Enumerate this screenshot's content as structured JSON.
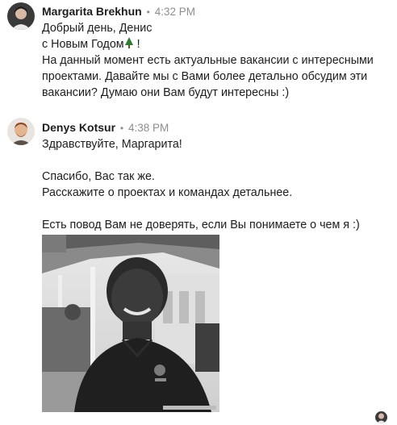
{
  "messages": [
    {
      "sender": "Margarita Brekhun",
      "time": "4:32 PM",
      "lines": [
        "Добрый день, Денис",
        "с Новым Годом",
        "На данный момент есть актуальные вакансии с интересными",
        "проектами. Давайте мы с Вами более детально обсудим эти",
        "вакансии? Думаю они Вам будут интересны :)"
      ],
      "inline_emoji": "tree-emoji",
      "after_emoji": " !"
    },
    {
      "sender": "Denys Kotsur",
      "time": "4:38 PM",
      "lines": [
        "Здравствуйте, Маргарита!",
        "Спасибо, Вас так же.",
        "Расскажите о проектах и командах детальнее.",
        "Есть повод Вам не доверять, если Вы понимаете о чем я :)"
      ],
      "attachment": "photo-attachment"
    }
  ],
  "separator": "•",
  "colors": {
    "text": "#1d1d1d",
    "meta": "#8e8e8e",
    "background": "#ffffff"
  }
}
